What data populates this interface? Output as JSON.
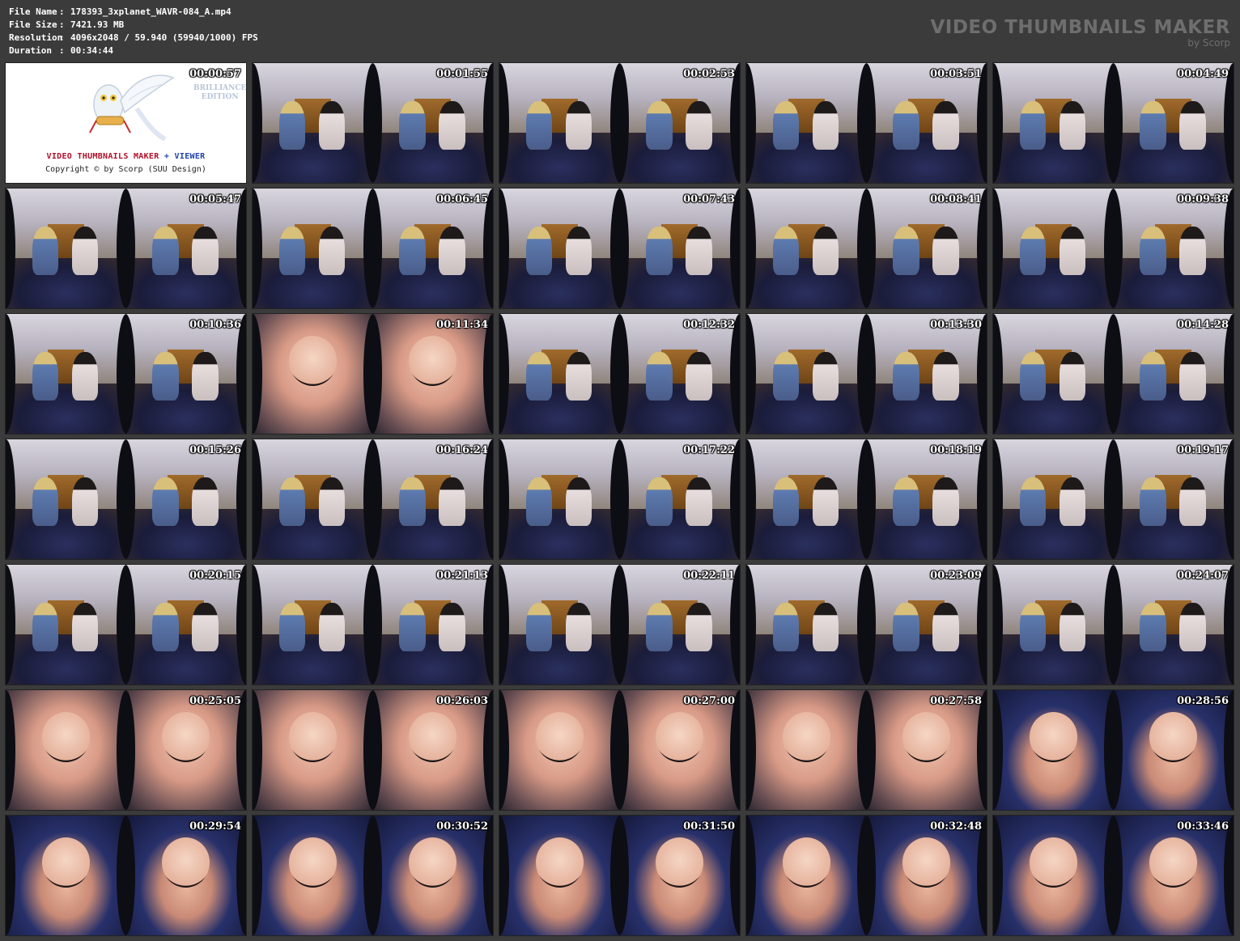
{
  "file_info": [
    {
      "key": "File Name",
      "value": "178393_3xplanet_WAVR-084_A.mp4"
    },
    {
      "key": "File Size",
      "value": "7421.93 MB"
    },
    {
      "key": "Resolution",
      "value": "4096x2048 / 59.940 (59940/1000) FPS"
    },
    {
      "key": "Duration",
      "value": "00:34:44"
    }
  ],
  "brand": {
    "title": "VIDEO THUMBNAILS MAKER",
    "subtitle": "by Scorp"
  },
  "logo": {
    "title_red": "VIDEO THUMBNAILS MAKER",
    "title_blue": "+ VIEWER",
    "copyright": "Copyright © by Scorp (SUU Design)",
    "edition_line1": "BRILLIANCE",
    "edition_line2": "EDITION",
    "timestamp": "00:00:57"
  },
  "thumbnails": [
    {
      "time": "00:01:55",
      "scene": "room"
    },
    {
      "time": "00:02:53",
      "scene": "room"
    },
    {
      "time": "00:03:51",
      "scene": "room"
    },
    {
      "time": "00:04:49",
      "scene": "room"
    },
    {
      "time": "00:05:47",
      "scene": "room"
    },
    {
      "time": "00:06:45",
      "scene": "room"
    },
    {
      "time": "00:07:43",
      "scene": "room"
    },
    {
      "time": "00:08:41",
      "scene": "room"
    },
    {
      "time": "00:09:38",
      "scene": "room"
    },
    {
      "time": "00:10:36",
      "scene": "room"
    },
    {
      "time": "00:11:34",
      "scene": "closeup"
    },
    {
      "time": "00:12:32",
      "scene": "room"
    },
    {
      "time": "00:13:30",
      "scene": "room"
    },
    {
      "time": "00:14:28",
      "scene": "room"
    },
    {
      "time": "00:15:26",
      "scene": "room"
    },
    {
      "time": "00:16:24",
      "scene": "room"
    },
    {
      "time": "00:17:22",
      "scene": "room"
    },
    {
      "time": "00:18:19",
      "scene": "room"
    },
    {
      "time": "00:19:17",
      "scene": "room"
    },
    {
      "time": "00:20:15",
      "scene": "room"
    },
    {
      "time": "00:21:13",
      "scene": "room"
    },
    {
      "time": "00:22:11",
      "scene": "room"
    },
    {
      "time": "00:23:09",
      "scene": "room"
    },
    {
      "time": "00:24:07",
      "scene": "room"
    },
    {
      "time": "00:25:05",
      "scene": "closeup"
    },
    {
      "time": "00:26:03",
      "scene": "closeup"
    },
    {
      "time": "00:27:00",
      "scene": "closeup"
    },
    {
      "time": "00:27:58",
      "scene": "closeup"
    },
    {
      "time": "00:28:56",
      "scene": "bed"
    },
    {
      "time": "00:29:54",
      "scene": "bed"
    },
    {
      "time": "00:30:52",
      "scene": "bed"
    },
    {
      "time": "00:31:50",
      "scene": "bed"
    },
    {
      "time": "00:32:48",
      "scene": "bed"
    },
    {
      "time": "00:33:46",
      "scene": "bed"
    }
  ]
}
